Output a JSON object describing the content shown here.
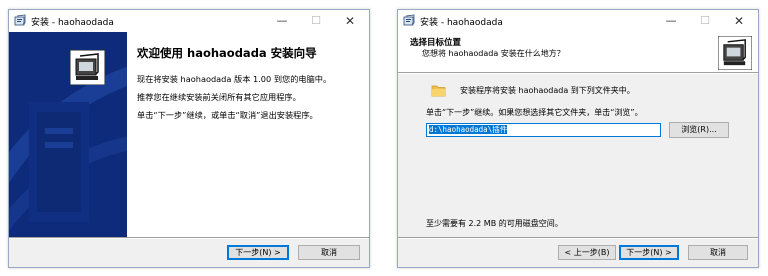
{
  "window_title": "安装 - haohaodada",
  "title_controls": {
    "minimize": "—",
    "maximize": "☐",
    "close": "✕"
  },
  "welcome": {
    "heading": "欢迎使用 haohaodada 安装向导",
    "line1": "现在将安装 haohaodada 版本 1.00 到您的电脑中。",
    "line2": "推荐您在继续安装前关闭所有其它应用程序。",
    "line3": "单击“下一步”继续，或单击“取消”退出安装程序。",
    "next_button": "下一步(N) >",
    "cancel_button": "取消"
  },
  "select_dir": {
    "header_title": "选择目标位置",
    "header_subtitle": "您想将 haohaodada 安装在什么地方？",
    "folder_text": "安装程序将安装 haohaodada 到下列文件夹中。",
    "instruction": "单击“下一步”继续。如果您想选择其它文件夹，单击“浏览”。",
    "path_value": "d:\\haohaodada\\插件",
    "browse_button": "浏览(R)...",
    "disk_space": "至少需要有 2.2 MB 的可用磁盘空间。",
    "back_button": "< 上一步(B)",
    "next_button": "下一步(N) >",
    "cancel_button": "取消"
  },
  "colors": {
    "banner": "#0d2b7a",
    "accent": "#0078d7",
    "dialog_bg": "#f0f0f0"
  }
}
